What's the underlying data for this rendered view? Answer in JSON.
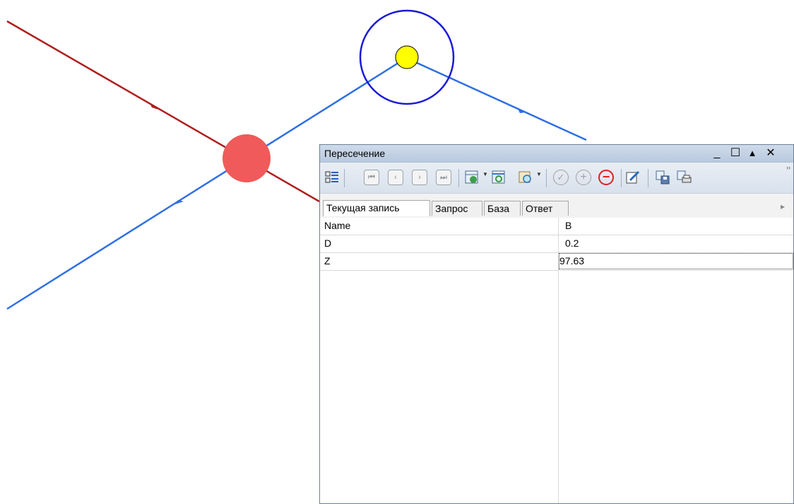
{
  "colors": {
    "red_line": "#b01e1e",
    "blue_line": "#2f6fe4",
    "red_point": "#f05a5a",
    "yellow_point": "#ffff00",
    "circle": "#1a1ad6"
  },
  "panel": {
    "title": "Пересечение",
    "window_buttons": {
      "minimize": "_",
      "maximize": "☐",
      "collapse": "▲",
      "close": "✕"
    },
    "toolbar": {
      "first": "⏮",
      "prev": "‹",
      "next": "›",
      "last": "⏭",
      "accept": "✓",
      "add": "+",
      "remove": "−",
      "overflow": "››"
    },
    "tabs": [
      "Текущая запись",
      "Запрос",
      "База",
      "Ответ"
    ],
    "tab_scroll": "▸",
    "grid": {
      "columns": [
        "Name",
        "B"
      ],
      "rows": [
        {
          "name": "D",
          "value": "0.2"
        },
        {
          "name": "Z",
          "value": "97.63"
        }
      ]
    }
  }
}
